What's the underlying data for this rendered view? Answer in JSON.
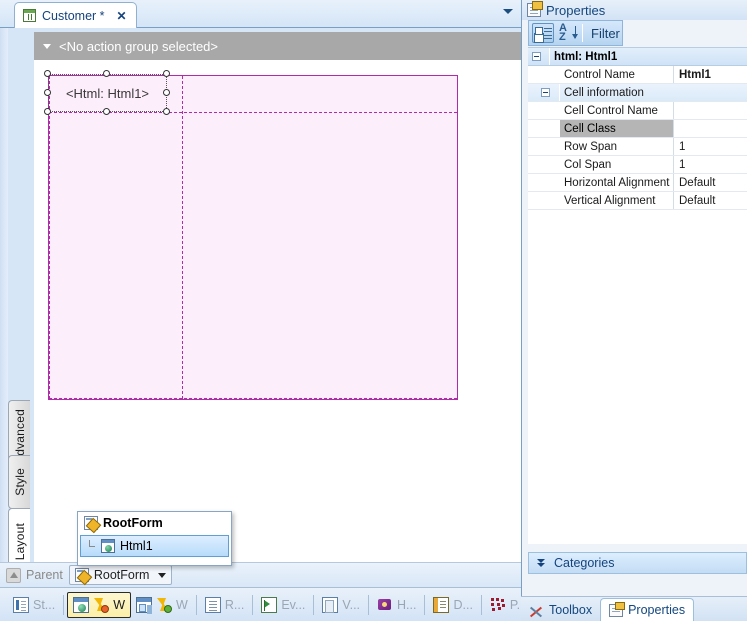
{
  "designer": {
    "tab": {
      "label": "Customer *",
      "close_label": "✕",
      "icon": "grid-document-icon"
    },
    "overflow_arrow_icon": "chevron-down-icon",
    "action_group_bar": {
      "text": "<No action group selected>",
      "caret_icon": "caret-down-icon"
    },
    "canvas": {
      "selected_control_label": "<Html: Html1>"
    },
    "side_tabs": [
      {
        "label": "Advanced"
      },
      {
        "label": "Style"
      },
      {
        "label": "Layout"
      }
    ],
    "parent_bar": {
      "parent_label": "Parent",
      "parent_icon": "up-arrow-icon",
      "combo_value": "RootForm",
      "combo_icon": "form-icon",
      "combo_caret_icon": "caret-down-icon"
    },
    "tree_popup": {
      "root": {
        "label": "RootForm",
        "icon": "form-icon"
      },
      "child": {
        "label": "Html1",
        "icon": "html-control-icon"
      }
    }
  },
  "taskbar": {
    "items": [
      {
        "label": "St...",
        "icon": "structure-icon",
        "active": false
      },
      {
        "label": "W",
        "icon": "web-form-bolt-red-icon",
        "active": true
      },
      {
        "label": "W",
        "icon": "web-form-bolt-green-icon",
        "active": false
      },
      {
        "label": "R...",
        "icon": "report-icon",
        "active": false
      },
      {
        "label": "Ev...",
        "icon": "events-icon",
        "active": false
      },
      {
        "label": "V...",
        "icon": "variables-icon",
        "active": false
      },
      {
        "label": "H...",
        "icon": "help-icon",
        "active": false
      },
      {
        "label": "D...",
        "icon": "documentation-icon",
        "active": false
      },
      {
        "label": "P...",
        "icon": "patterns-icon",
        "active": false
      }
    ]
  },
  "properties": {
    "title": "Properties",
    "title_icon": "properties-icon",
    "toolbar": {
      "categorized_icon": "categorized-view-icon",
      "sort_icon": "sort-alphabetical-icon",
      "filter_label": "Filter"
    },
    "grid": {
      "header": {
        "label": "html: Html1"
      },
      "rows": [
        {
          "name": "Control Name",
          "value": "Html1",
          "type": "value",
          "bold_value": true,
          "indent": 0
        },
        {
          "name": "Cell information",
          "value": "",
          "type": "category",
          "indent": 0
        },
        {
          "name": "Cell Control Name",
          "value": "",
          "type": "value",
          "indent": 1
        },
        {
          "name": "Cell Class",
          "value": "",
          "type": "value",
          "indent": 1,
          "selected": true
        },
        {
          "name": "Row Span",
          "value": "1",
          "type": "value",
          "indent": 1
        },
        {
          "name": "Col Span",
          "value": "1",
          "type": "value",
          "indent": 1
        },
        {
          "name": "Horizontal Alignment",
          "value": "Default",
          "type": "value",
          "indent": 1
        },
        {
          "name": "Vertical Alignment",
          "value": "Default",
          "type": "value",
          "indent": 1
        }
      ]
    },
    "categories_bar": {
      "label": "Categories",
      "icon": "double-chevron-down-icon"
    }
  },
  "dock_tabs": [
    {
      "label": "Toolbox",
      "icon": "toolbox-icon",
      "active": false
    },
    {
      "label": "Properties",
      "icon": "properties-icon",
      "active": true
    }
  ],
  "colors": {
    "accent_blue": "#15437d",
    "table_fill": "#fdeefb",
    "table_border": "#b02ba8",
    "action_bar_gray": "#a8a8a8",
    "selected_row_gray": "#b5b5b5",
    "active_task_yellow": "#fcefa8"
  }
}
